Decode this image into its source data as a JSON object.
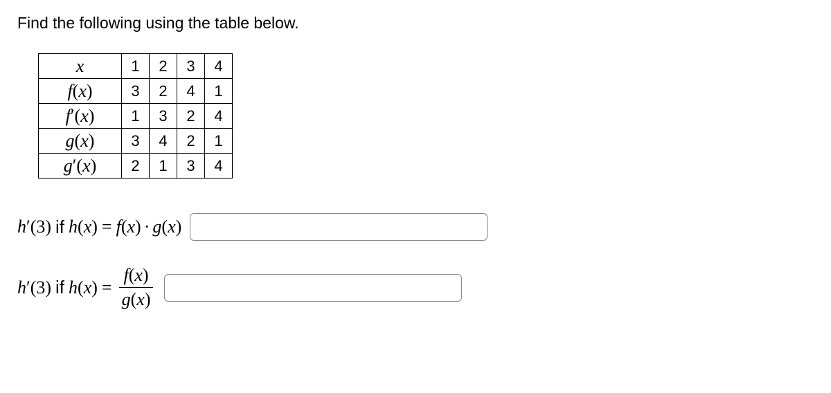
{
  "instruction": "Find the following using the table below.",
  "table": {
    "rows": [
      {
        "label": "x",
        "values": [
          "1",
          "2",
          "3",
          "4"
        ]
      },
      {
        "label": "f(x)",
        "values": [
          "3",
          "2",
          "4",
          "1"
        ]
      },
      {
        "label": "f′(x)",
        "values": [
          "1",
          "3",
          "2",
          "4"
        ]
      },
      {
        "label": "g(x)",
        "values": [
          "3",
          "4",
          "2",
          "1"
        ]
      },
      {
        "label": "g′(x)",
        "values": [
          "2",
          "1",
          "3",
          "4"
        ]
      }
    ]
  },
  "questions": {
    "q1": {
      "hprime": "h′",
      "arg": "(3)",
      "if": "if",
      "hx": "h(x)",
      "eq": "=",
      "fx": "f(x)",
      "dot": "·",
      "gx": "g(x)",
      "value": ""
    },
    "q2": {
      "hprime": "h′",
      "arg": "(3)",
      "if": "if",
      "hx": "h(x)",
      "eq": "=",
      "fx": "f(x)",
      "gx": "g(x)",
      "value": ""
    }
  }
}
